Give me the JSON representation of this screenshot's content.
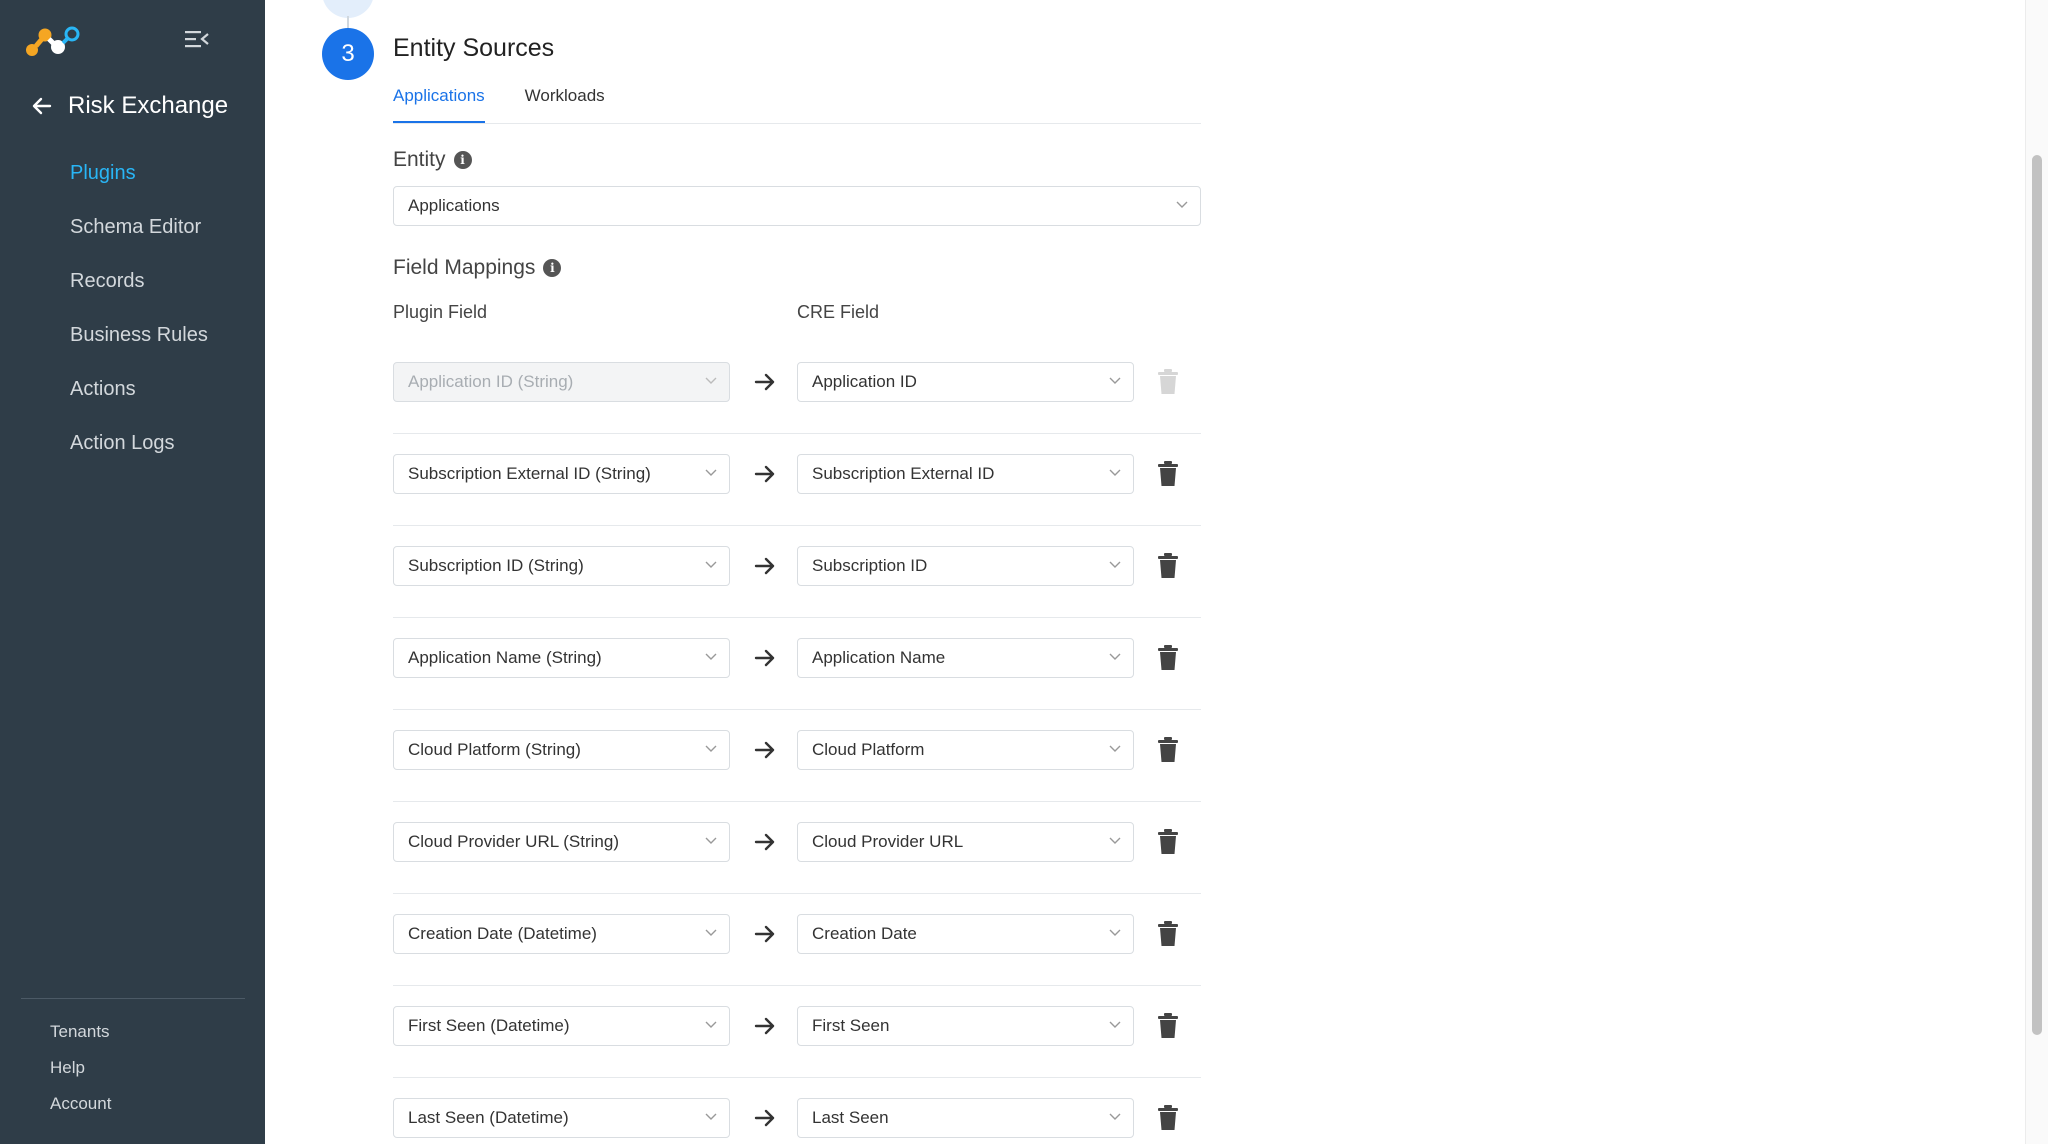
{
  "sidebar": {
    "app_title": "Risk Exchange",
    "nav": [
      {
        "label": "Plugins",
        "active": true
      },
      {
        "label": "Schema Editor",
        "active": false
      },
      {
        "label": "Records",
        "active": false
      },
      {
        "label": "Business Rules",
        "active": false
      },
      {
        "label": "Actions",
        "active": false
      },
      {
        "label": "Action Logs",
        "active": false
      }
    ],
    "bottom": [
      {
        "label": "Tenants"
      },
      {
        "label": "Help"
      },
      {
        "label": "Account"
      }
    ]
  },
  "step": {
    "number": "3",
    "title": "Entity Sources"
  },
  "tabs": [
    {
      "label": "Applications",
      "active": true
    },
    {
      "label": "Workloads",
      "active": false
    }
  ],
  "entity": {
    "label": "Entity",
    "value": "Applications"
  },
  "field_mappings": {
    "label": "Field Mappings",
    "plugin_field_header": "Plugin Field",
    "cre_field_header": "CRE Field",
    "rows": [
      {
        "plugin": "Application ID (String)",
        "cre": "Application ID",
        "disabled": true
      },
      {
        "plugin": "Subscription External ID (String)",
        "cre": "Subscription External ID",
        "disabled": false
      },
      {
        "plugin": "Subscription ID (String)",
        "cre": "Subscription ID",
        "disabled": false
      },
      {
        "plugin": "Application Name (String)",
        "cre": "Application Name",
        "disabled": false
      },
      {
        "plugin": "Cloud Platform (String)",
        "cre": "Cloud Platform",
        "disabled": false
      },
      {
        "plugin": "Cloud Provider URL (String)",
        "cre": "Cloud Provider URL",
        "disabled": false
      },
      {
        "plugin": "Creation Date (Datetime)",
        "cre": "Creation Date",
        "disabled": false
      },
      {
        "plugin": "First Seen (Datetime)",
        "cre": "First Seen",
        "disabled": false
      },
      {
        "plugin": "Last Seen (Datetime)",
        "cre": "Last Seen",
        "disabled": false
      }
    ]
  },
  "colors": {
    "sidebar_bg": "#2f3d48",
    "accent": "#1a73e8",
    "nav_active": "#29b6f6"
  },
  "icons": {
    "logo": "netskope-logo-icon",
    "collapse": "menu-collapse-icon",
    "back": "arrow-left-icon",
    "info": "info-icon",
    "map_arrow": "arrow-right-icon",
    "delete": "trash-icon",
    "dropdown": "chevron-down-icon"
  }
}
